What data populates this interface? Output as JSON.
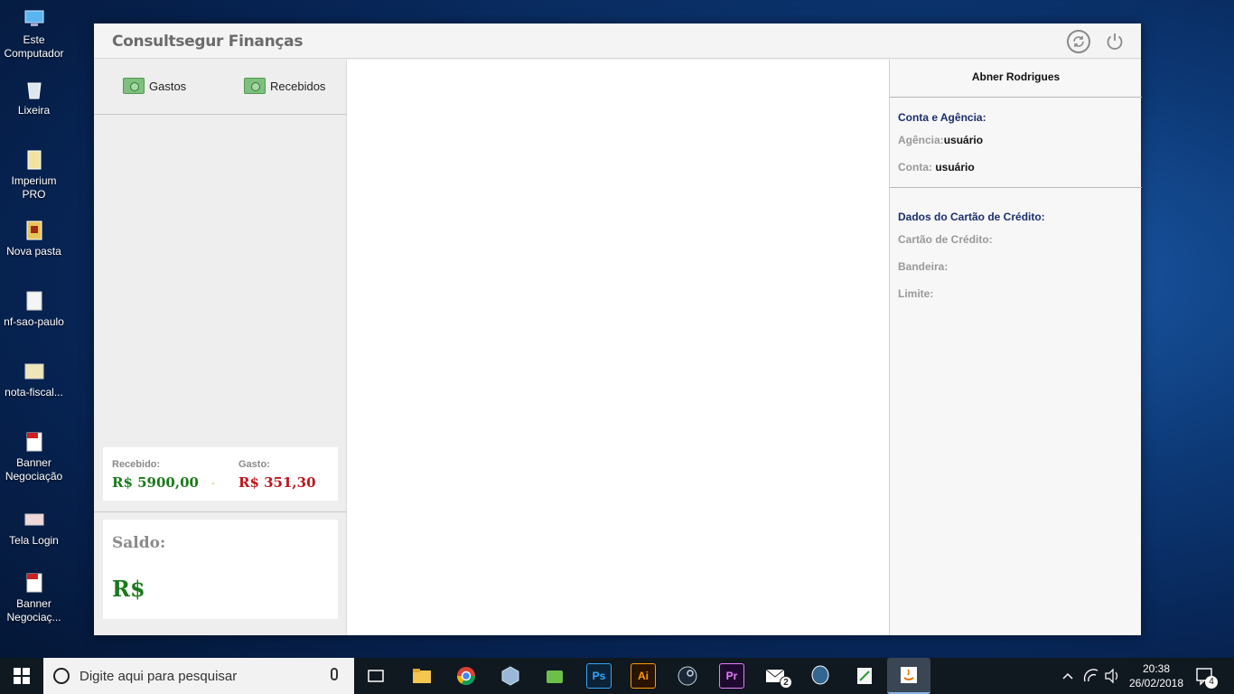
{
  "desktop": {
    "icons": [
      {
        "label": "Este\nComputador",
        "icon": "computer-icon"
      },
      {
        "label": "Lixeira",
        "icon": "recycle-bin-icon"
      },
      {
        "label": "Imperium\nPRO",
        "icon": "document-icon"
      },
      {
        "label": "Nova pasta",
        "icon": "folder-icon"
      },
      {
        "label": "nf-sao-paulo",
        "icon": "image-file-icon"
      },
      {
        "label": "nota-fiscal...",
        "icon": "image-file-icon"
      },
      {
        "label": "Banner\nNegociação",
        "icon": "pdf-icon"
      },
      {
        "label": "Tela Login",
        "icon": "image-file-icon"
      },
      {
        "label": "Banner\nNegociaç...",
        "icon": "pdf-icon"
      }
    ]
  },
  "app": {
    "title": "Consultsegur Finanças",
    "nav": {
      "gastos": "Gastos",
      "recebidos": "Recebidos"
    },
    "summary": {
      "recebido_label": "Recebido:",
      "recebido_value": "R$ 5900,00",
      "dash": "-",
      "gasto_label": "Gasto:",
      "gasto_value": "R$ 351,30"
    },
    "saldo": {
      "label": "Saldo:",
      "value": "R$"
    },
    "user": {
      "name": "Abner Rodrigues",
      "conta_section": "Conta e Agência:",
      "agencia_label": "Agência:",
      "agencia_value": "usuário",
      "conta_label": "Conta:",
      "conta_value": "usuário",
      "cartao_section": "Dados do Cartão de Crédito:",
      "cartao_label": "Cartão de Crédito:",
      "bandeira_label": "Bandeira:",
      "limite_label": "Limite:"
    },
    "colors": {
      "positive": "#1a7a1a",
      "negative": "#c0141c",
      "section": "#1c2e6c"
    }
  },
  "taskbar": {
    "search_placeholder": "Digite aqui para pesquisar",
    "time": "20:38",
    "date": "26/02/2018",
    "mail_badge": "2",
    "notification_count": "4",
    "apps": [
      "task-view-icon",
      "file-explorer-icon",
      "chrome-icon",
      "virtualbox-icon",
      "android-icon",
      "photoshop-icon",
      "illustrator-icon",
      "steam-icon",
      "premiere-icon",
      "mail-icon",
      "postgres-icon",
      "editor-icon",
      "java-icon"
    ],
    "ps_label": "Ps",
    "ai_label": "Ai",
    "pr_label": "Pr"
  }
}
